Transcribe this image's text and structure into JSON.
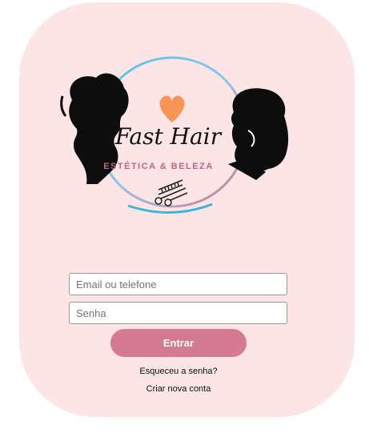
{
  "logo": {
    "brand_name": "Fast Hair",
    "tagline": "ESTÉTICA & BELEZA",
    "icons": [
      "woman-silhouette-icon",
      "man-silhouette-icon",
      "heart-icon",
      "comb-scissors-icon"
    ],
    "colors": {
      "ring_start": "#4cc9e8",
      "ring_end": "#d47a92",
      "heart": "#f79654",
      "tagline": "#c2638a"
    }
  },
  "form": {
    "email_placeholder": "Email ou telefone",
    "password_placeholder": "Senha",
    "submit_label": "Entrar",
    "forgot_label": "Esqueceu a senha?",
    "create_label": "Criar nova conta"
  },
  "colors": {
    "card_background": "#fde4e5",
    "button": "#d47a92"
  }
}
